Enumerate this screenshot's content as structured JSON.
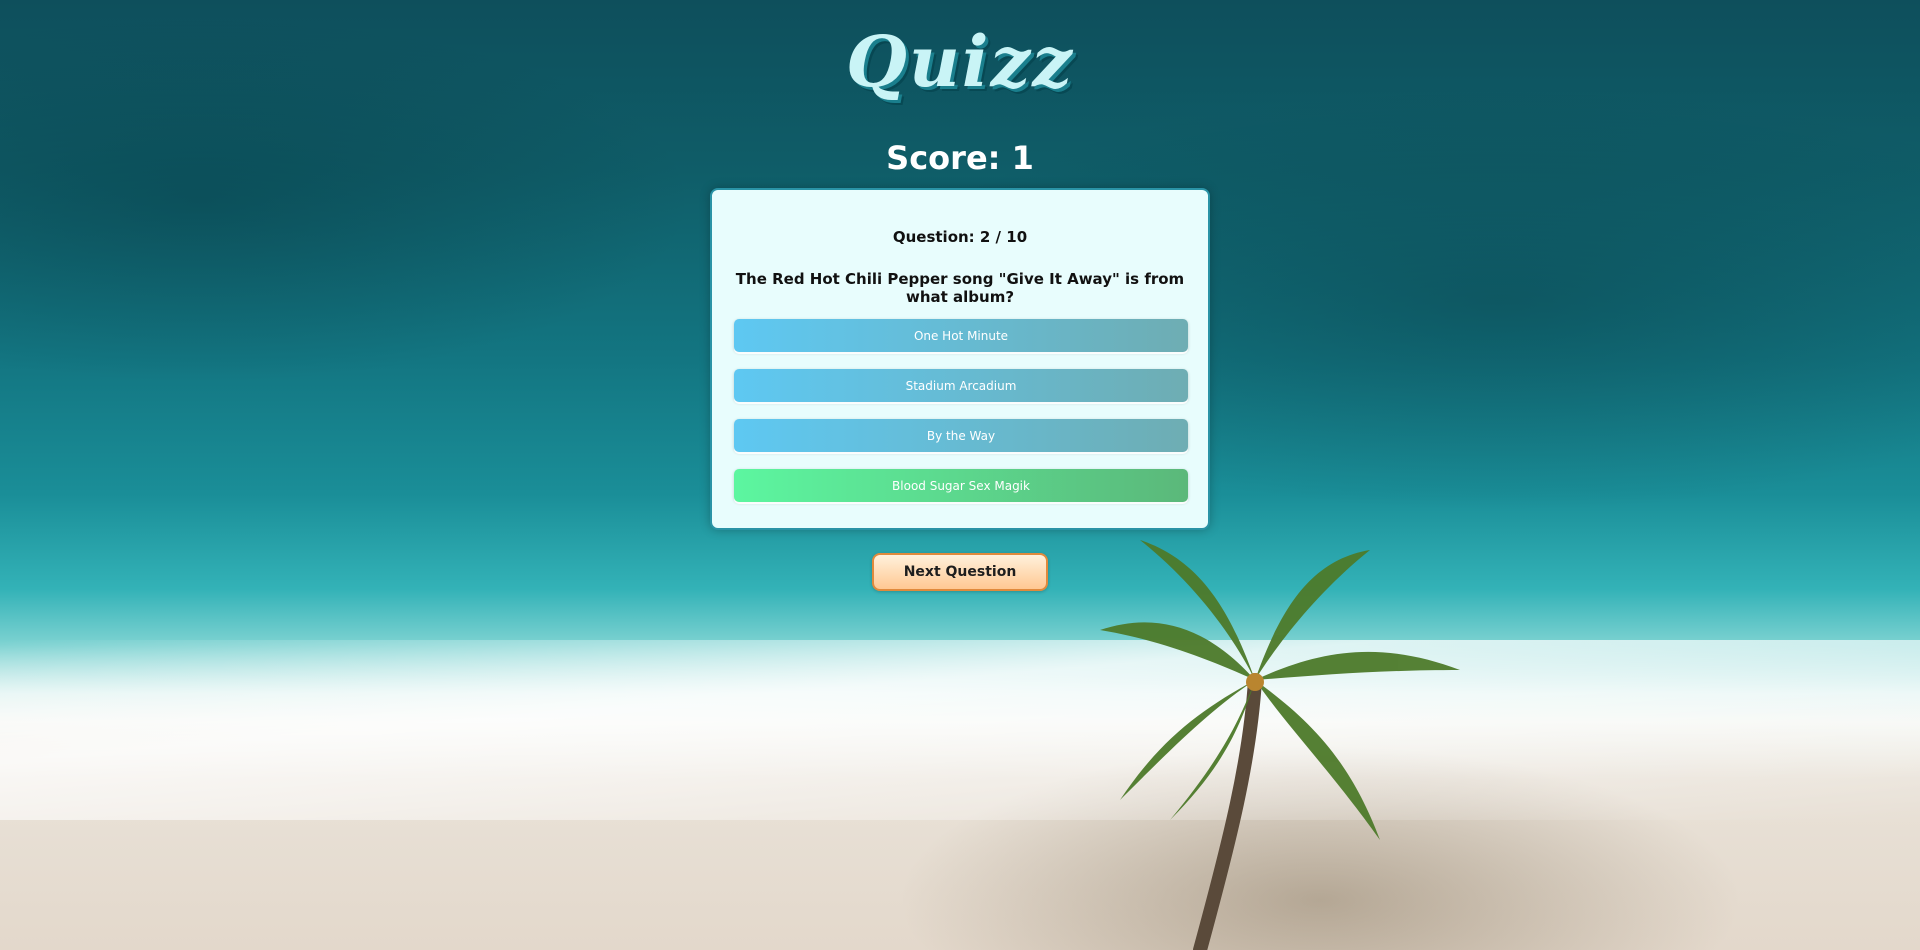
{
  "app": {
    "logo": "Quizz"
  },
  "score": {
    "label": "Score: 1"
  },
  "question": {
    "count": "Question: 2 / 10",
    "text": "The Red Hot Chili Pepper song \"Give It Away\" is from what album?",
    "answers": [
      {
        "label": "One Hot Minute",
        "state": "neutral"
      },
      {
        "label": "Stadium Arcadium",
        "state": "neutral"
      },
      {
        "label": "By the Way",
        "state": "neutral"
      },
      {
        "label": "Blood Sugar Sex Magik",
        "state": "correct"
      }
    ]
  },
  "controls": {
    "next_label": "Next Question"
  },
  "colors": {
    "answer_neutral": "#5ec8f2",
    "answer_correct": "#5cf6a0",
    "next_border": "#e08a3c",
    "card_background": "#e8fdfd"
  },
  "background": {
    "scene": "tropical-beach-palm-image"
  }
}
